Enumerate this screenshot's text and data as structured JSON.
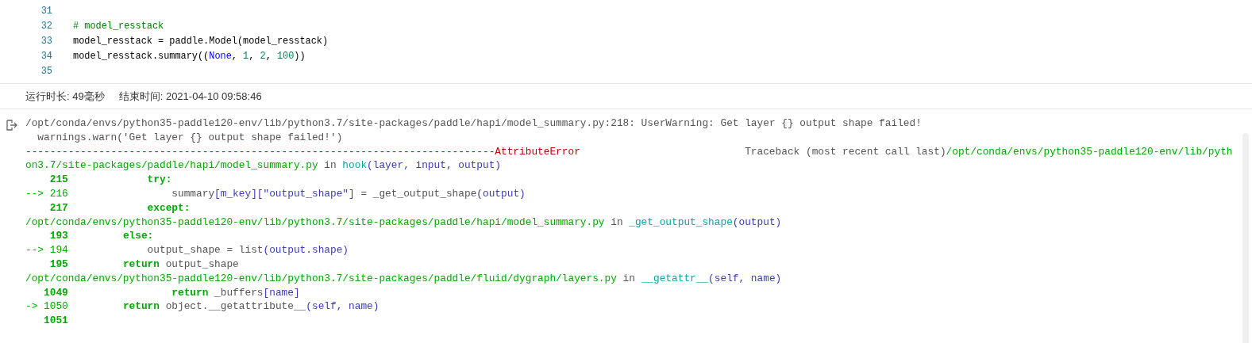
{
  "code_cell": {
    "lines": [
      {
        "number": "31"
      },
      {
        "number": "32",
        "tokens": [
          {
            "kind": "comment",
            "text": "# model_resstack"
          }
        ]
      },
      {
        "number": "33",
        "tokens": [
          {
            "kind": "plain",
            "text": "model_resstack = paddle.Model(model_resstack)"
          }
        ]
      },
      {
        "number": "34",
        "tokens": [
          {
            "kind": "plain",
            "text": "model_resstack.summary(("
          },
          {
            "kind": "constant",
            "text": "None"
          },
          {
            "kind": "plain",
            "text": ", "
          },
          {
            "kind": "number",
            "text": "1"
          },
          {
            "kind": "plain",
            "text": ", "
          },
          {
            "kind": "number",
            "text": "2"
          },
          {
            "kind": "plain",
            "text": ", "
          },
          {
            "kind": "number",
            "text": "100"
          },
          {
            "kind": "plain",
            "text": "))"
          }
        ]
      },
      {
        "number": "35"
      }
    ]
  },
  "run_info": {
    "duration": "运行时长: 49毫秒",
    "end_time": "结束时间: 2021-04-10 09:58:46"
  },
  "output": {
    "lines": [
      [
        {
          "kind": "plain",
          "text": "/opt/conda/envs/python35-paddle120-env/lib/python3.7/site-packages/paddle/hapi/model_summary.py:218: UserWarning: Get layer {} output shape failed!"
        }
      ],
      [
        {
          "kind": "plain",
          "text": "  warnings.warn('Get layer {} output shape failed!')"
        }
      ],
      [
        {
          "kind": "error",
          "text": "-----------------------------------------------------------------------------AttributeError"
        },
        {
          "kind": "traceback",
          "text": "Traceback (most recent call last)"
        },
        {
          "kind": "path",
          "text": "/opt/conda/envs/python35-paddle120-env/lib/pyth"
        }
      ],
      [
        {
          "kind": "path",
          "text": "on3.7/site-packages/paddle/hapi/model_summary.py"
        },
        {
          "kind": "plain",
          "text": " in "
        },
        {
          "kind": "function",
          "text": "hook"
        },
        {
          "kind": "args",
          "text": "(layer, input, output)"
        }
      ],
      [
        {
          "kind": "lineno",
          "text": "    215"
        },
        {
          "kind": "keyword",
          "text": "             try:"
        }
      ],
      [
        {
          "kind": "path",
          "text": "--> 216"
        },
        {
          "kind": "plain",
          "text": "                 summary"
        },
        {
          "kind": "args",
          "text": "[m_key][\"output_shape\"]"
        },
        {
          "kind": "plain",
          "text": " = _get_output_shape"
        },
        {
          "kind": "args",
          "text": "(output)"
        }
      ],
      [
        {
          "kind": "lineno",
          "text": "    217"
        },
        {
          "kind": "keyword",
          "text": "             except:"
        }
      ],
      [
        {
          "kind": "path",
          "text": "/opt/conda/envs/python35-paddle120-env/lib/python3.7/site-packages/paddle/hapi/model_summary.py"
        },
        {
          "kind": "plain",
          "text": " in "
        },
        {
          "kind": "function",
          "text": "_get_output_shape"
        },
        {
          "kind": "args",
          "text": "(output)"
        }
      ],
      [
        {
          "kind": "lineno",
          "text": "    193"
        },
        {
          "kind": "keyword",
          "text": "         else:"
        }
      ],
      [
        {
          "kind": "path",
          "text": "--> 194"
        },
        {
          "kind": "plain",
          "text": "             output_shape = list"
        },
        {
          "kind": "args",
          "text": "(output.shape)"
        }
      ],
      [
        {
          "kind": "lineno",
          "text": "    195"
        },
        {
          "kind": "keyword",
          "text": "         return"
        },
        {
          "kind": "plain",
          "text": " output_shape"
        }
      ],
      [
        {
          "kind": "path",
          "text": "/opt/conda/envs/python35-paddle120-env/lib/python3.7/site-packages/paddle/fluid/dygraph/layers.py"
        },
        {
          "kind": "plain",
          "text": " in "
        },
        {
          "kind": "function",
          "text": "__getattr__"
        },
        {
          "kind": "args",
          "text": "(self, name)"
        }
      ],
      [
        {
          "kind": "lineno",
          "text": "   1049"
        },
        {
          "kind": "keyword",
          "text": "                 return"
        },
        {
          "kind": "plain",
          "text": " _buffers"
        },
        {
          "kind": "args",
          "text": "[name]"
        }
      ],
      [
        {
          "kind": "path",
          "text": "-> 1050"
        },
        {
          "kind": "keyword",
          "text": "         return"
        },
        {
          "kind": "plain",
          "text": " object.__getattribute__"
        },
        {
          "kind": "args",
          "text": "(self, name)"
        }
      ],
      [
        {
          "kind": "lineno",
          "text": "   1051"
        }
      ]
    ]
  }
}
